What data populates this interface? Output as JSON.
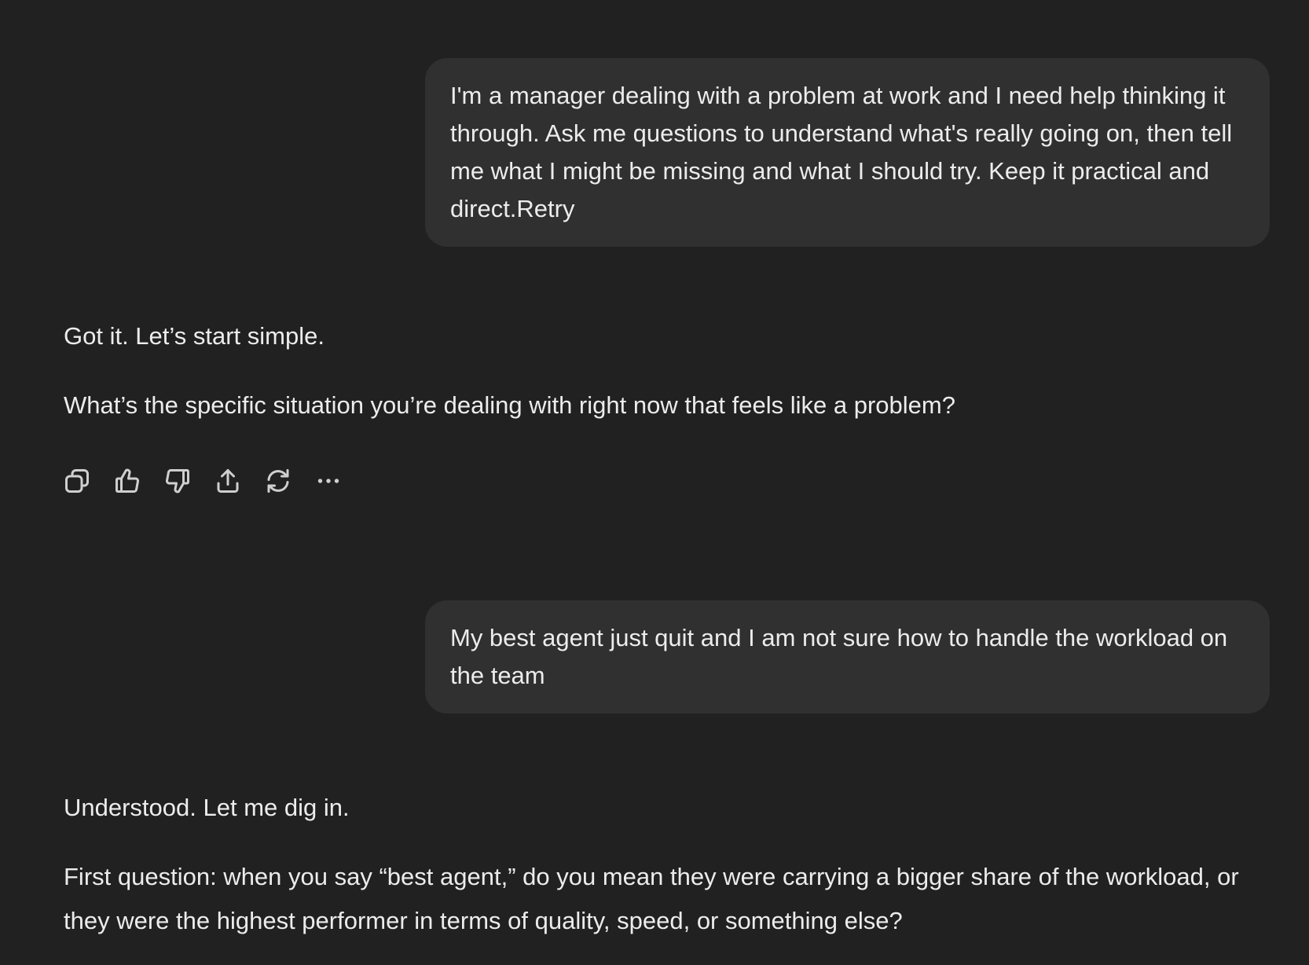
{
  "conversation": {
    "user_messages": [
      {
        "text": "I'm a manager dealing with a problem at work and I need help thinking it through. Ask me questions to understand what's really going on, then tell me what I might be missing and what I should try. Keep it practical and direct.Retry"
      },
      {
        "text": "My best agent just quit and I am not sure how to handle the workload on the team"
      }
    ],
    "assistant_messages": [
      {
        "paragraphs": [
          "Got it. Let’s start simple.",
          "What’s the specific situation you’re dealing with right now that feels like a problem?"
        ]
      },
      {
        "paragraphs": [
          "Understood. Let me dig in.",
          "First question: when you say “best agent,” do you mean they were carrying a bigger share of the workload, or they were the highest performer in terms of quality, speed, or something else?"
        ]
      }
    ]
  },
  "actions": {
    "icons": [
      "copy-icon",
      "thumbs-up-icon",
      "thumbs-down-icon",
      "share-icon",
      "retry-icon",
      "more-icon"
    ]
  },
  "theme": {
    "background": "#212121",
    "bubble": "#303030",
    "text": "#ececec",
    "icon": "#cfcfcf"
  }
}
